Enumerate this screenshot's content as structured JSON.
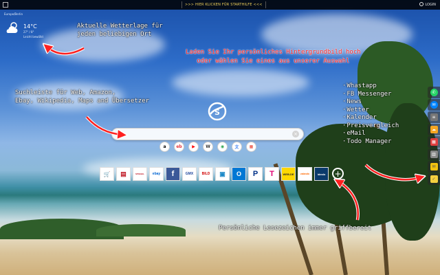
{
  "topbar": {
    "center_label": ">>> HIER KLICKEN FÜR STARTHILFE <<<",
    "login_label": "LOGIN"
  },
  "weather": {
    "city": "Europe/Berlin",
    "temp": "14°C",
    "range": "27° / 8°",
    "description": "Leicht bewölkt",
    "icon": "cloud-sun-icon"
  },
  "annotations": {
    "weather": [
      "Aktuelle Wetterlage für",
      "jeden beliebigen Ort"
    ],
    "background": [
      "Laden Sie Ihr persönliches Hintergrundbild hoch",
      "oder wählen Sie eines aus unserer Auswahl"
    ],
    "search": [
      "Suchleiste für Web, Amazon,",
      "Ebay, Wikipedia, Maps and Übersetzer"
    ],
    "bookmarks": "Persönliche Lesezeichen immer griffbereit"
  },
  "features": [
    "Whastapp",
    "FB Messenger",
    "News",
    "Wetter",
    "Kalender",
    "Preisvergleich",
    "eMail",
    "Todo Manager"
  ],
  "search": {
    "placeholder": "",
    "clear_icon": "close-icon"
  },
  "engines": [
    {
      "name": "amazon",
      "glyph": "a",
      "color": "#000000"
    },
    {
      "name": "ebay",
      "glyph": "eb",
      "color": "#e53238"
    },
    {
      "name": "youtube",
      "glyph": "▶",
      "color": "#ff0000"
    },
    {
      "name": "wikipedia",
      "glyph": "W",
      "color": "#333333"
    },
    {
      "name": "maps",
      "glyph": "◉",
      "color": "#34a853"
    },
    {
      "name": "translate",
      "glyph": "文",
      "color": "#4285f4"
    },
    {
      "name": "more",
      "glyph": "▦",
      "color": "#ea4335"
    }
  ],
  "bookmarks": [
    {
      "name": "shop",
      "glyph": "🛒",
      "color": "#1a5fb4"
    },
    {
      "name": "news",
      "glyph": "▤",
      "color": "#c01c28"
    },
    {
      "name": "spiegel",
      "glyph": "SPIEGEL",
      "color": "#c01c28"
    },
    {
      "name": "ebay",
      "glyph": "ebay",
      "color": "#0064d2"
    },
    {
      "name": "facebook",
      "glyph": "f",
      "color": "#3b5998"
    },
    {
      "name": "gmx",
      "glyph": "GMX",
      "color": "#1c449b"
    },
    {
      "name": "bild",
      "glyph": "BILD",
      "color": "#d00000"
    },
    {
      "name": "web-de",
      "glyph": "▣",
      "color": "#1b88c7"
    },
    {
      "name": "outlook",
      "glyph": "O",
      "color": "#0078d4"
    },
    {
      "name": "paypal",
      "glyph": "P",
      "color": "#003087"
    },
    {
      "name": "telekom",
      "glyph": "T",
      "color": "#e20074"
    },
    {
      "name": "webde",
      "glyph": "WEB.DE",
      "color": "#222222"
    },
    {
      "name": "zalando",
      "glyph": "zalando",
      "color": "#ff6900"
    },
    {
      "name": "idealo",
      "glyph": "idealo",
      "color": "#0a3a6b"
    }
  ],
  "sidebar": [
    {
      "name": "whatsapp",
      "icon": "whatsapp-icon",
      "glyph": "✆",
      "color": "#25d366"
    },
    {
      "name": "messenger",
      "icon": "messenger-icon",
      "glyph": "✉",
      "color": "#0084ff"
    },
    {
      "name": "news",
      "icon": "news-icon",
      "glyph": "≡",
      "color": "#777777"
    },
    {
      "name": "weather",
      "icon": "weather-icon",
      "glyph": "☁",
      "color": "#f5a623"
    },
    {
      "name": "calendar",
      "icon": "calendar-icon",
      "glyph": "▦",
      "color": "#e04040"
    },
    {
      "name": "pricecompare",
      "icon": "price-icon",
      "glyph": "▥",
      "color": "#888888"
    },
    {
      "name": "email",
      "icon": "email-icon",
      "glyph": "✉",
      "color": "#f1c40f"
    },
    {
      "name": "todo",
      "icon": "todo-icon",
      "glyph": "✓",
      "color": "#f4d03f"
    }
  ]
}
